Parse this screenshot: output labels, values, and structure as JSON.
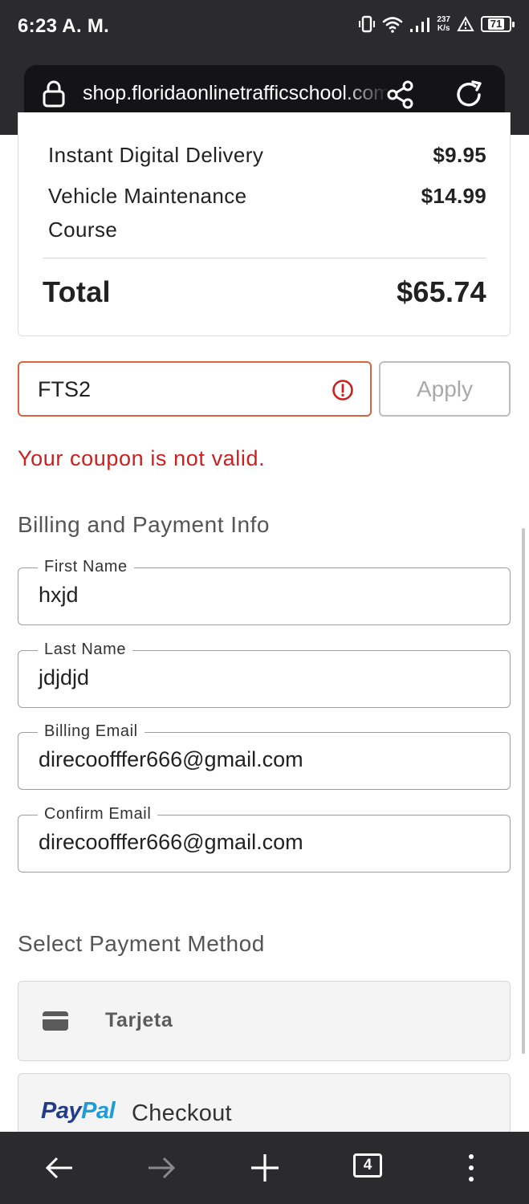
{
  "status_bar": {
    "time": "6:23 A. M.",
    "net_speed_value": "237",
    "net_speed_unit": "K/s",
    "battery": "71"
  },
  "browser": {
    "url": "shop.floridaonlinetrafficschool.com"
  },
  "order_summary": {
    "items": [
      {
        "name": "Instant Digital Delivery",
        "price": "$9.95"
      },
      {
        "name": "Vehicle Maintenance Course",
        "price": "$14.99"
      }
    ],
    "total_label": "Total",
    "total_value": "$65.74"
  },
  "coupon": {
    "value": "FTS2",
    "apply_label": "Apply",
    "error_message": "Your coupon is not valid."
  },
  "billing": {
    "heading": "Billing and Payment Info",
    "fields": [
      {
        "label": "First Name",
        "value": "hxjd"
      },
      {
        "label": "Last Name",
        "value": "jdjdjd"
      },
      {
        "label": "Billing Email",
        "value": "direcoofffer666@gmail.com"
      },
      {
        "label": "Confirm Email",
        "value": "direcoofffer666@gmail.com"
      }
    ]
  },
  "payment": {
    "heading": "Select Payment Method",
    "card_label": "Tarjeta",
    "paypal_pay": "Pay",
    "paypal_pal": "Pal",
    "paypal_checkout": "Checkout"
  },
  "bottom_nav": {
    "tab_count": "4"
  },
  "colors": {
    "error": "#cc1f1f",
    "error_border": "#d9643c",
    "paypal_dark": "#233c88",
    "paypal_light": "#1f9bd7",
    "chrome_bar": "#2b2b2e"
  }
}
